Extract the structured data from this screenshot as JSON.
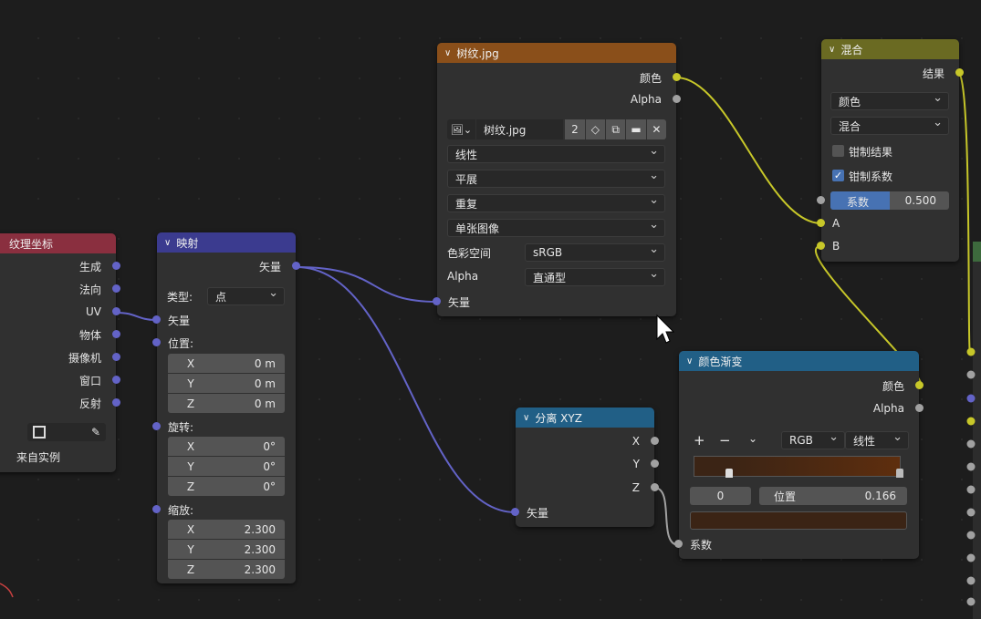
{
  "texcoord": {
    "title": "纹理坐标",
    "outputs": [
      "生成",
      "法向",
      "UV",
      "物体",
      "摄像机",
      "窗口",
      "反射"
    ],
    "from_instancer": "来自实例"
  },
  "mapping": {
    "title": "映射",
    "output": "矢量",
    "type_label": "类型:",
    "type_value": "点",
    "input_vector": "矢量",
    "location_label": "位置:",
    "location": [
      {
        "axis": "X",
        "value": "0 m"
      },
      {
        "axis": "Y",
        "value": "0 m"
      },
      {
        "axis": "Z",
        "value": "0 m"
      }
    ],
    "rotation_label": "旋转:",
    "rotation": [
      {
        "axis": "X",
        "value": "0°"
      },
      {
        "axis": "Y",
        "value": "0°"
      },
      {
        "axis": "Z",
        "value": "0°"
      }
    ],
    "scale_label": "缩放:",
    "scale": [
      {
        "axis": "X",
        "value": "2.300"
      },
      {
        "axis": "Y",
        "value": "2.300"
      },
      {
        "axis": "Z",
        "value": "2.300"
      }
    ]
  },
  "image": {
    "title": "树纹.jpg",
    "out_color": "颜色",
    "out_alpha": "Alpha",
    "image_name": "树纹.jpg",
    "users": "2",
    "interpolation": "线性",
    "projection": "平展",
    "extension": "重复",
    "source": "单张图像",
    "colorspace_label": "色彩空间",
    "colorspace": "sRGB",
    "alpha_label": "Alpha",
    "alpha_mode": "直通型",
    "input_vector": "矢量"
  },
  "mix": {
    "title": "混合",
    "output": "结果",
    "data_type": "颜色",
    "blend": "混合",
    "clamp_result": "钳制结果",
    "clamp_factor": "钳制系数",
    "clamp_result_checked": false,
    "clamp_factor_checked": true,
    "factor_label": "系数",
    "factor_value": "0.500",
    "factor": 0.5,
    "input_a": "A",
    "input_b": "B"
  },
  "separate": {
    "title": "分离 XYZ",
    "outputs": [
      "X",
      "Y",
      "Z"
    ],
    "input": "矢量"
  },
  "ramp": {
    "title": "颜色渐变",
    "out_color": "颜色",
    "out_alpha": "Alpha",
    "add": "+",
    "remove": "−",
    "mode": "RGB",
    "interp": "线性",
    "index": "0",
    "pos_label": "位置",
    "pos_value": "0.166",
    "input": "系数",
    "stops": [
      0.166,
      1.0
    ],
    "color_left": "#3b2415",
    "color_right": "#5e2e0e"
  },
  "colors": {
    "header_texcoord": "#8a2f3f",
    "header_mapping": "#3b3b8f",
    "header_image": "#8a4f1a",
    "header_mix": "#6a6a22",
    "header_vector": "#215f86",
    "link_yellow": "#c7c729",
    "link_purple": "#6363c7",
    "link_gray": "#a1a1a1"
  }
}
